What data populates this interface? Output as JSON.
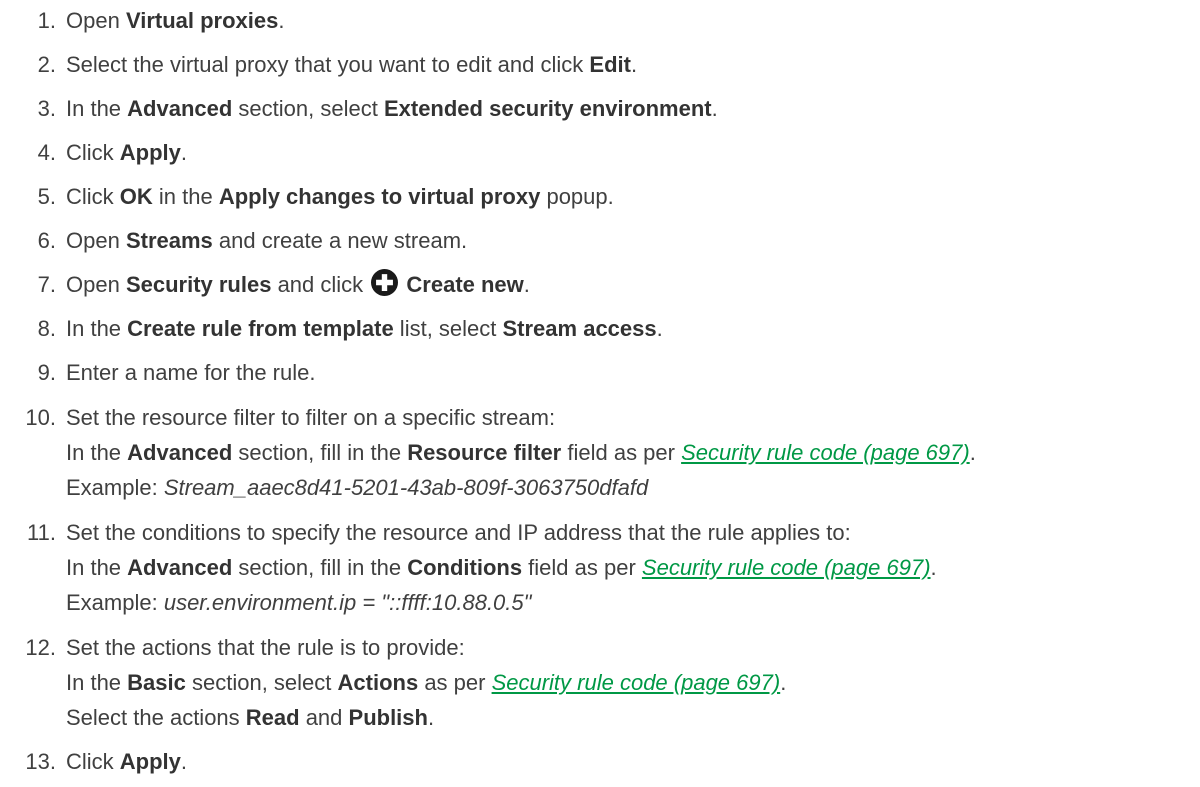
{
  "steps": [
    {
      "num": "1",
      "parts": [
        {
          "t": "Open "
        },
        {
          "b": "Virtual proxies"
        },
        {
          "t": "."
        }
      ]
    },
    {
      "num": "2",
      "parts": [
        {
          "t": "Select the virtual proxy that you want to edit and click "
        },
        {
          "b": "Edit"
        },
        {
          "t": "."
        }
      ]
    },
    {
      "num": "3",
      "parts": [
        {
          "t": "In the "
        },
        {
          "b": "Advanced"
        },
        {
          "t": " section, select "
        },
        {
          "b": "Extended security environment"
        },
        {
          "t": "."
        }
      ]
    },
    {
      "num": "4",
      "parts": [
        {
          "t": "Click "
        },
        {
          "b": "Apply"
        },
        {
          "t": "."
        }
      ]
    },
    {
      "num": "5",
      "parts": [
        {
          "t": "Click "
        },
        {
          "b": "OK"
        },
        {
          "t": " in the "
        },
        {
          "b": "Apply changes to virtual proxy"
        },
        {
          "t": " popup."
        }
      ]
    },
    {
      "num": "6",
      "parts": [
        {
          "t": "Open "
        },
        {
          "b": "Streams"
        },
        {
          "t": " and create a new stream."
        }
      ]
    },
    {
      "num": "7",
      "parts": [
        {
          "t": "Open "
        },
        {
          "b": "Security rules"
        },
        {
          "t": " and click "
        },
        {
          "icon": "plus-circle-icon"
        },
        {
          "b": " Create new"
        },
        {
          "t": "."
        }
      ]
    },
    {
      "num": "8",
      "parts": [
        {
          "t": "In the "
        },
        {
          "b": "Create rule from template"
        },
        {
          "t": " list, select "
        },
        {
          "b": "Stream access"
        },
        {
          "t": "."
        }
      ]
    },
    {
      "num": "9",
      "parts": [
        {
          "t": "Enter a name for the rule."
        }
      ]
    },
    {
      "num": "10",
      "lines": [
        [
          {
            "t": "Set the resource filter to filter on a specific stream:"
          }
        ],
        [
          {
            "t": "In the "
          },
          {
            "b": "Advanced"
          },
          {
            "t": " section, fill in the "
          },
          {
            "b": "Resource filter"
          },
          {
            "t": " field as per "
          },
          {
            "link": "Security rule code (page 697)"
          },
          {
            "t": "."
          }
        ],
        [
          {
            "t": "Example: "
          },
          {
            "i": "Stream_aaec8d41-5201-43ab-809f-3063750dfafd"
          }
        ]
      ]
    },
    {
      "num": "11",
      "lines": [
        [
          {
            "t": "Set the conditions to specify the resource and IP address that the rule applies to:"
          }
        ],
        [
          {
            "t": "In the "
          },
          {
            "b": "Advanced"
          },
          {
            "t": " section, fill in the "
          },
          {
            "b": "Conditions"
          },
          {
            "t": " field as per "
          },
          {
            "link": "Security rule code (page 697)"
          },
          {
            "t": "."
          }
        ],
        [
          {
            "t": "Example: "
          },
          {
            "i": "user.environment.ip = \"::ffff:10.88.0.5\""
          }
        ]
      ]
    },
    {
      "num": "12",
      "lines": [
        [
          {
            "t": "Set the actions that the rule is to provide:"
          }
        ],
        [
          {
            "t": "In the "
          },
          {
            "b": "Basic"
          },
          {
            "t": " section, select "
          },
          {
            "b": "Actions"
          },
          {
            "t": " as per "
          },
          {
            "link": "Security rule code (page 697)"
          },
          {
            "t": "."
          }
        ],
        [
          {
            "t": "Select the actions "
          },
          {
            "b": "Read"
          },
          {
            "t": " and "
          },
          {
            "b": "Publish"
          },
          {
            "t": "."
          }
        ]
      ]
    },
    {
      "num": "13",
      "parts": [
        {
          "t": "Click "
        },
        {
          "b": "Apply"
        },
        {
          "t": "."
        }
      ]
    }
  ],
  "colors": {
    "text": "#404040",
    "link": "#009845",
    "icon": "#1a1a1a"
  }
}
